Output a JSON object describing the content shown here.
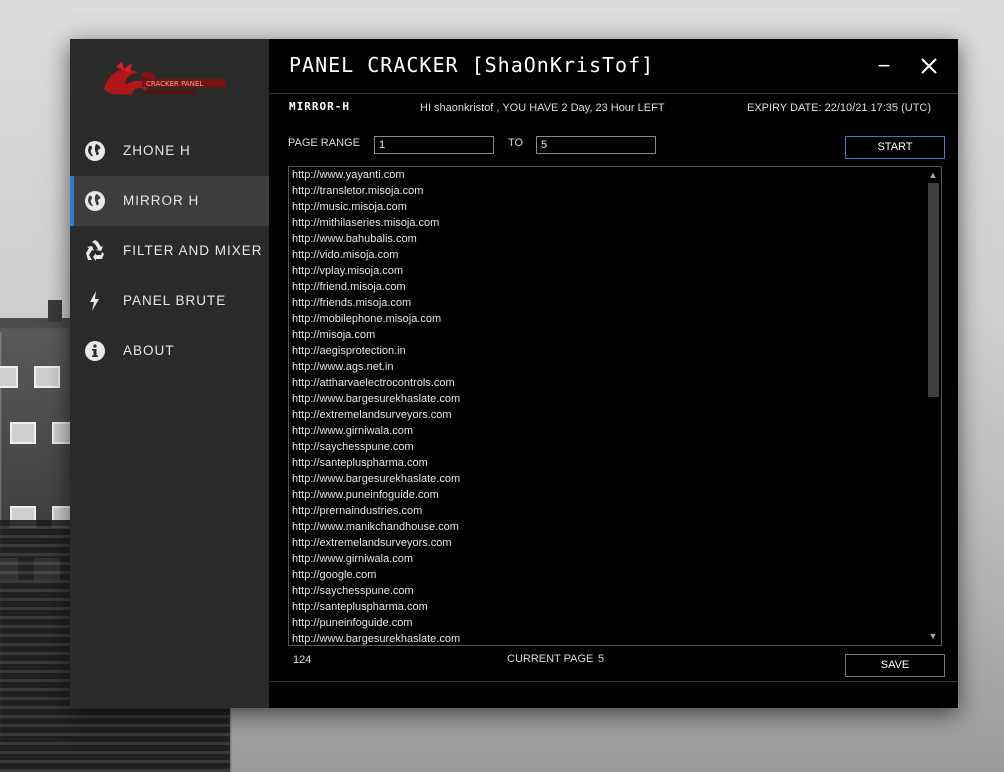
{
  "app": {
    "title": "PANEL CRACKER [ShaOnKrisTof]",
    "logo_text": "CRACKER PANEL",
    "accent_color": "#2d7fd6"
  },
  "window_controls": {
    "minimize": "−",
    "close": "✕"
  },
  "sidebar": {
    "items": [
      {
        "label": "ZHONE H",
        "icon": "globe-icon",
        "active": false
      },
      {
        "label": "MIRROR H",
        "icon": "globe-icon",
        "active": true
      },
      {
        "label": "FILTER AND MIXER",
        "icon": "recycle-icon",
        "active": false
      },
      {
        "label": "PANEL BRUTE",
        "icon": "lightning-icon",
        "active": false
      },
      {
        "label": "ABOUT",
        "icon": "info-icon",
        "active": false
      }
    ]
  },
  "header": {
    "section_title": "MIRROR-H",
    "greeting": "HI shaonkristof , YOU HAVE 2 Day, 23 Hour LEFT",
    "expiry": "EXPIRY DATE: 22/10/21 17:35 (UTC)"
  },
  "controls": {
    "page_range_label": "PAGE RANGE",
    "page_from": "1",
    "to_label": "TO",
    "page_to": "5",
    "start_label": "START",
    "save_label": "SAVE"
  },
  "urls": [
    "http://www.yayanti.com",
    "http://transletor.misoja.com",
    "http://music.misoja.com",
    "http://mithilaseries.misoja.com",
    "http://www.bahubalis.com",
    "http://vido.misoja.com",
    "http://vplay.misoja.com",
    "http://friend.misoja.com",
    "http://friends.misoja.com",
    "http://mobilephone.misoja.com",
    "http://misoja.com",
    "http://aegisprotection.in",
    "http://www.ags.net.in",
    "http://attharvaelectrocontrols.com",
    "http://www.bargesurekhaslate.com",
    "http://extremelandsurveyors.com",
    "http://www.girniwala.com",
    "http://saychesspune.com",
    "http://santepluspharma.com",
    "http://www.bargesurekhaslate.com",
    "http://www.puneinfoguide.com",
    "http://prernaindustries.com",
    "http://www.manikchandhouse.com",
    "http://extremelandsurveyors.com",
    "http://www.girniwala.com",
    "http://google.com",
    "http://saychesspune.com",
    "http://santepluspharma.com",
    "http://puneinfoguide.com",
    "http://www.bargesurekhaslate.com"
  ],
  "footer": {
    "count": "124",
    "current_page_label": "CURRENT PAGE",
    "current_page": "5"
  }
}
